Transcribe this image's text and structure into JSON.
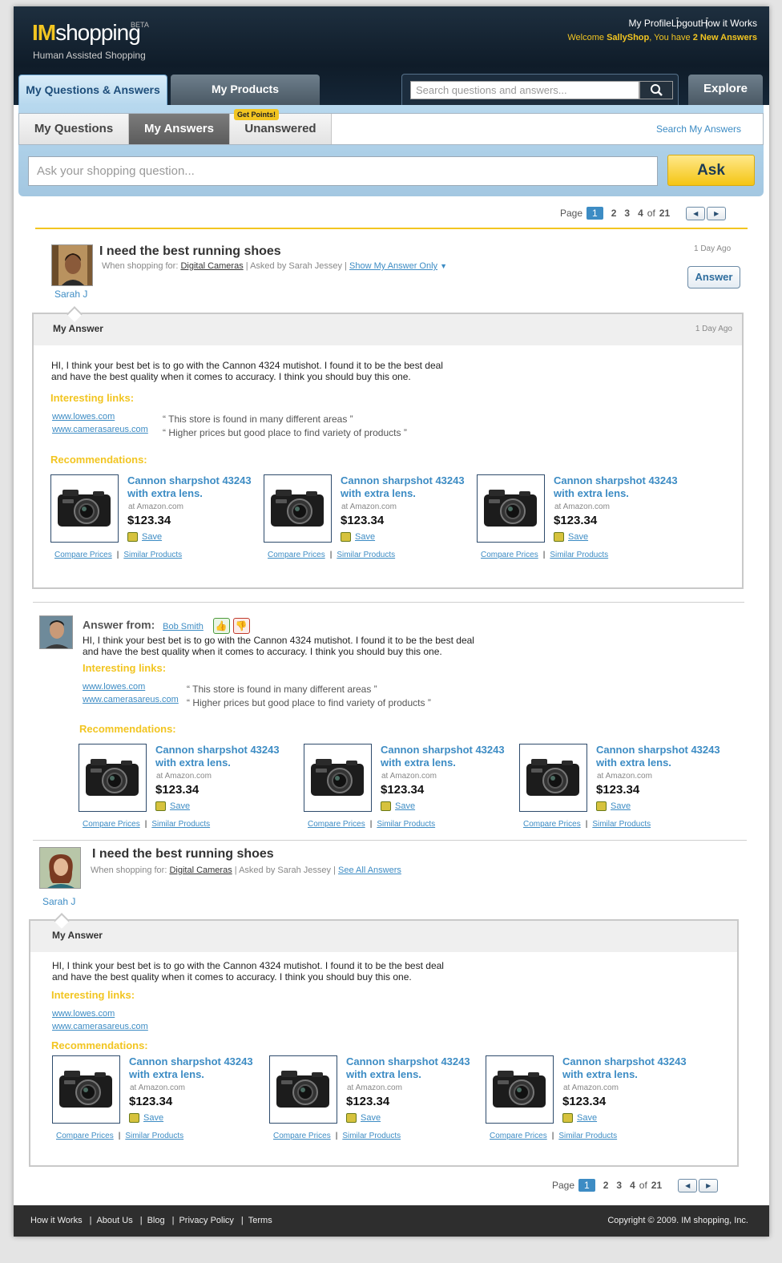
{
  "brand": {
    "im": "IM",
    "shopping": "shopping",
    "beta": "BETA",
    "tagline": "Human Assisted Shopping"
  },
  "toplinks": [
    "My Profile",
    "Logout",
    "How it Works"
  ],
  "welcome": {
    "prefix": "Welcome ",
    "user": "SallyShop",
    "mid": ", You have ",
    "count": "2 New Answers"
  },
  "tabs": {
    "qa": "My Questions & Answers",
    "products": "My Products",
    "explore": "Explore"
  },
  "search": {
    "placeholder": "Search questions and answers..."
  },
  "subtabs": {
    "questions": "My Questions",
    "answers": "My Answers",
    "unanswered": "Unanswered",
    "badge": "Get Points!",
    "search_mine": "Search My Answers"
  },
  "ask": {
    "placeholder": "Ask your shopping question...",
    "button": "Ask"
  },
  "pager": {
    "label": "Page",
    "pages": [
      "1",
      "2",
      "3",
      "4"
    ],
    "of": "of",
    "total": "21"
  },
  "q1": {
    "title": "I need the best running shoes",
    "shopping_for": "When shopping for:",
    "category": "Digital Cameras",
    "asked_by": "Asked by Sarah Jessey",
    "link": "Show My Answer Only",
    "age": "1 Day Ago",
    "user": "Sarah J",
    "answer_btn": "Answer"
  },
  "my_answer": {
    "header": "My Answer",
    "age": "1 Day Ago",
    "line1": "HI, I think your best bet is to go with the Cannon 4324 mutishot. I found it to be the best deal",
    "line2": "and have the best quality when it comes to accuracy. I think you should buy this one."
  },
  "labels": {
    "interesting": "Interesting links:",
    "recs": "Recommendations:",
    "answer_from": "Answer from:",
    "compare": "Compare Prices",
    "similar": "Similar Products",
    "save": "Save"
  },
  "links": [
    {
      "url": "www.lowes.com",
      "quote": "“ This store is found in many different areas ”"
    },
    {
      "url": "www.camerasareus.com",
      "quote": "“ Higher prices but good place to find variety of products ”"
    }
  ],
  "product": {
    "title1": "Cannon sharpshot 43243",
    "title2": "with extra lens.",
    "store": "at Amazon.com",
    "price": "$123.34"
  },
  "answer2": {
    "user": "Bob Smith"
  },
  "q2": {
    "title": "I need the best running shoes",
    "shopping_for": "When shopping for:",
    "category": "Digital Cameras",
    "asked_by": "Asked by Sarah Jessey",
    "link": "See All Answers",
    "user": "Sarah J"
  },
  "footer": {
    "links": [
      "How it Works",
      "About Us",
      "Blog",
      "Privacy Policy",
      "Terms"
    ],
    "copyright": "Copyright © 2009. IM shopping, Inc."
  },
  "colors": {
    "accent": "#3d8cc4",
    "gold": "#f2c521",
    "header": "#152637"
  }
}
